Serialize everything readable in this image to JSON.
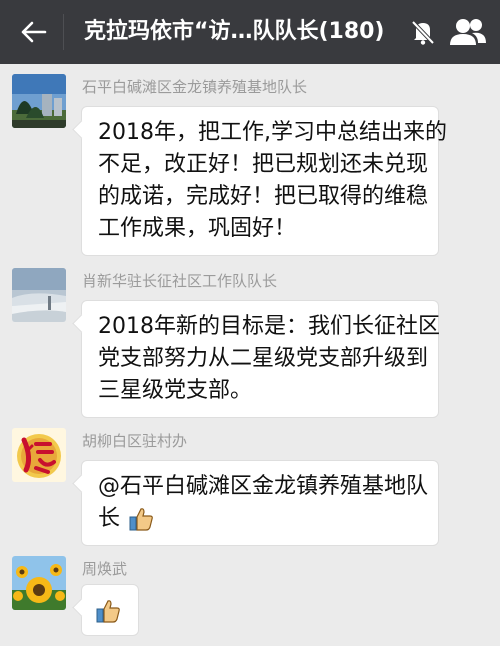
{
  "header": {
    "title": "克拉玛依市“访…队队长(180)",
    "back_icon": "arrow-left-icon",
    "mute_icon": "bell-muted-icon",
    "members_icon": "group-members-icon"
  },
  "messages": [
    {
      "sender": "石平白碱滩区金龙镇养殖基地队长",
      "avatar": "city-park-photo",
      "lines": [
        "2018年，把工作,学习中总结出来的",
        "不足，改正好！把已规划还未兑现",
        "的成诺，完成好！把已取得的维稳",
        "工作成果，巩固好！"
      ]
    },
    {
      "sender": "肖新华驻长征社区工作队队长",
      "avatar": "misty-landscape-photo",
      "lines": [
        "2018年新的目标是：我们长征社区",
        "党支部努力从二星级党支部升级到",
        "三星级党支部。"
      ]
    },
    {
      "sender": "胡柳白区驻村办",
      "avatar": "fu-character-image",
      "lines": [
        "@石平白碱滩区金龙镇养殖基地队",
        "长"
      ],
      "emoji": "thumbs-up-icon"
    },
    {
      "sender": "周焕武",
      "avatar": "sunflower-photo",
      "lines": [],
      "emoji": "thumbs-up-icon"
    }
  ],
  "colors": {
    "header_bg": "#393a3e",
    "chat_bg": "#ebebeb",
    "bubble_bg": "#ffffff",
    "sender_text": "#9b9b9b"
  }
}
